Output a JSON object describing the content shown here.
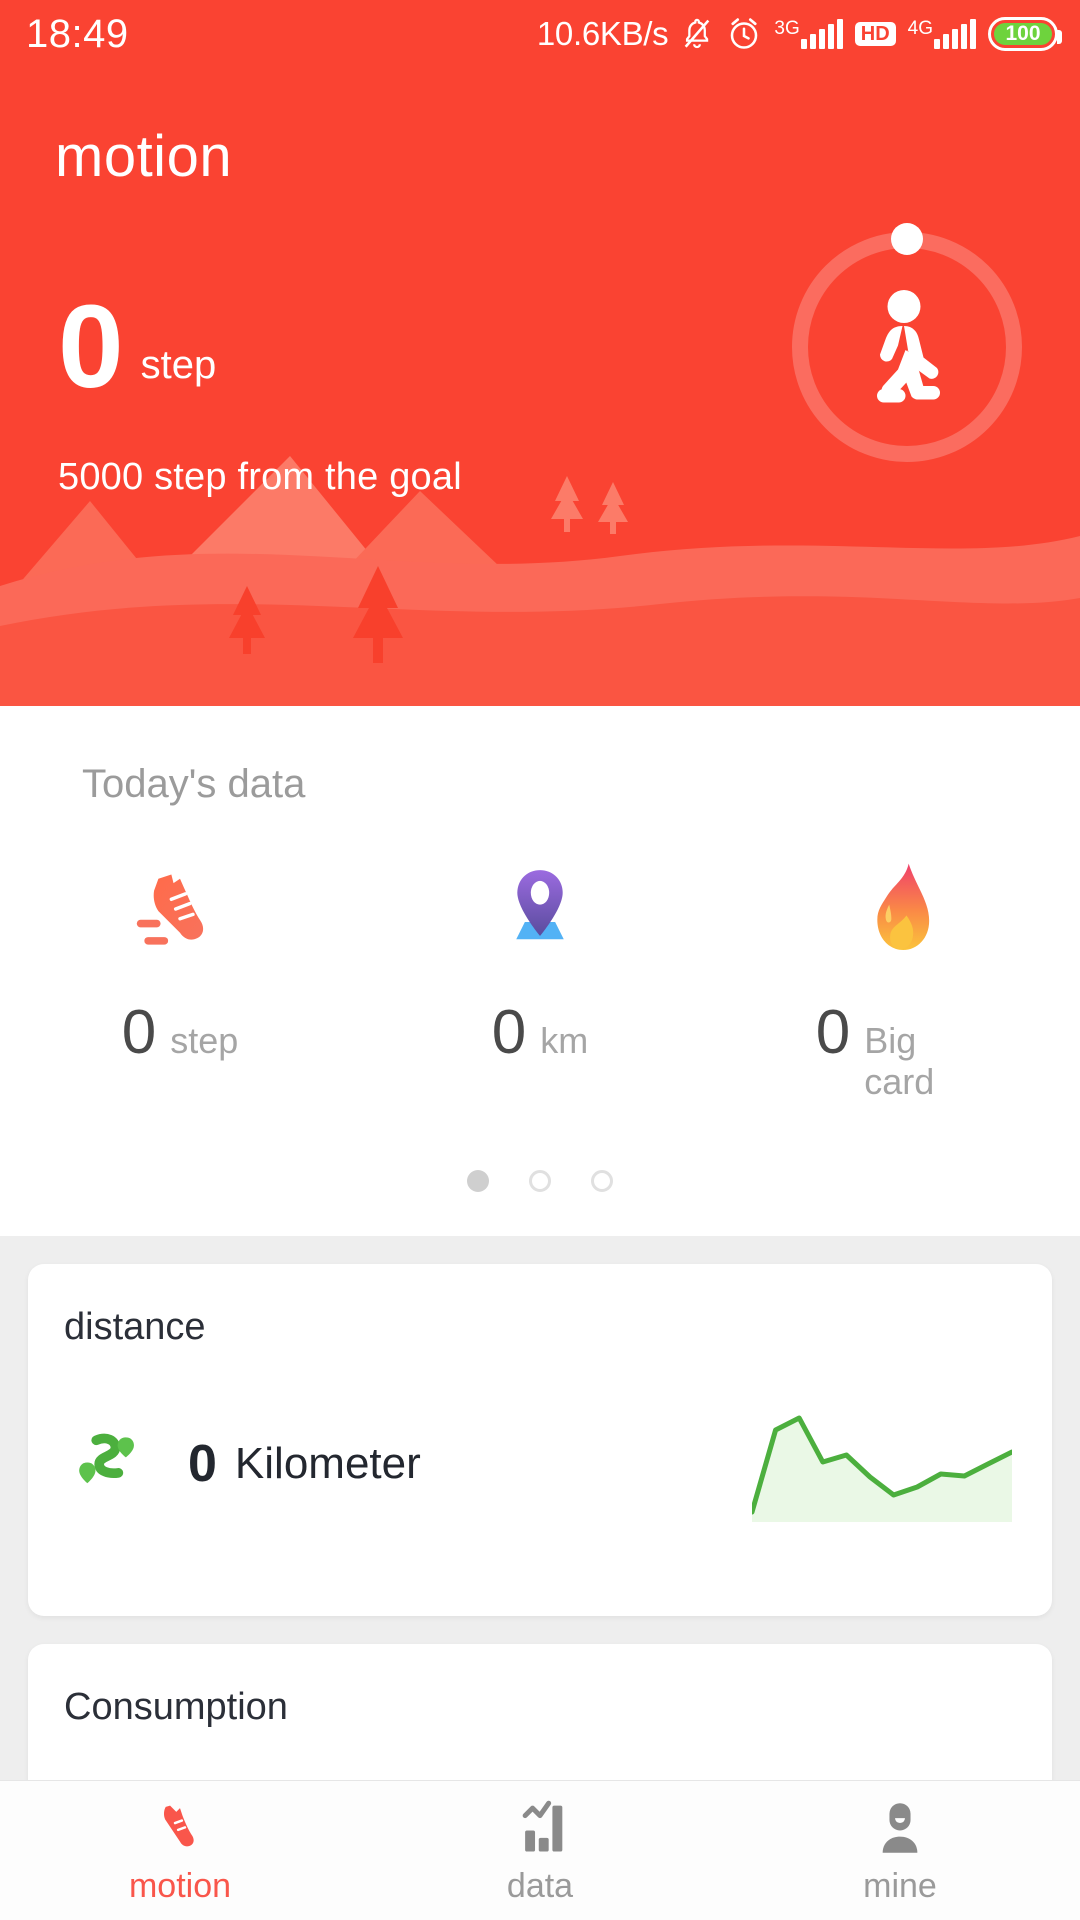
{
  "status_bar": {
    "time": "18:49",
    "network_speed": "10.6KB/s",
    "icons": [
      "bell-off-icon",
      "alarm-icon",
      "signal-3g-icon",
      "hd-icon",
      "signal-4g-icon",
      "battery-icon"
    ],
    "net_label_1": "3G",
    "hd_label": "HD",
    "net_label_2": "4G",
    "battery_level": "100",
    "battery_color": "#6ED33D",
    "background_color": "#FA4332"
  },
  "header": {
    "title": "motion",
    "step_count": "0",
    "step_unit": "step",
    "goal_text": "5000 step from the goal",
    "walker_icon": "walking-person-icon",
    "background_color": "#FA4332"
  },
  "today": {
    "title": "Today's data",
    "stats": [
      {
        "icon": "running-shoe-icon",
        "value": "0",
        "unit": "step"
      },
      {
        "icon": "location-pin-icon",
        "value": "0",
        "unit": "km"
      },
      {
        "icon": "flame-icon",
        "value": "0",
        "unit": "Big card"
      }
    ],
    "pager": {
      "count": 3,
      "active_index": 0
    }
  },
  "cards": [
    {
      "title": "distance",
      "icon": "green-road-icon",
      "value": "0",
      "unit": "Kilometer",
      "accent_color": "#4CAF3E"
    },
    {
      "title": "Consumption"
    }
  ],
  "chart_data": {
    "type": "area",
    "title": "distance",
    "series": [
      {
        "name": "distance",
        "values": [
          0.0,
          0.82,
          1.0,
          0.55,
          0.62,
          0.4,
          0.22,
          0.3,
          0.42,
          0.4,
          0.52,
          0.62
        ]
      }
    ],
    "x": [
      0,
      1,
      2,
      3,
      4,
      5,
      6,
      7,
      8,
      9,
      10,
      11
    ],
    "line_color": "#4CAF3E",
    "fill_color": "#EAF8E6",
    "grid": false,
    "legend": "none",
    "xlabel": "",
    "ylabel": ""
  },
  "bottom_nav": {
    "items": [
      {
        "label": "motion",
        "icon": "shoe-icon",
        "active": true
      },
      {
        "label": "data",
        "icon": "bar-chart-icon",
        "active": false
      },
      {
        "label": "mine",
        "icon": "person-icon",
        "active": false
      }
    ],
    "active_color": "#F9564B",
    "idle_color": "#9a9a9a"
  }
}
